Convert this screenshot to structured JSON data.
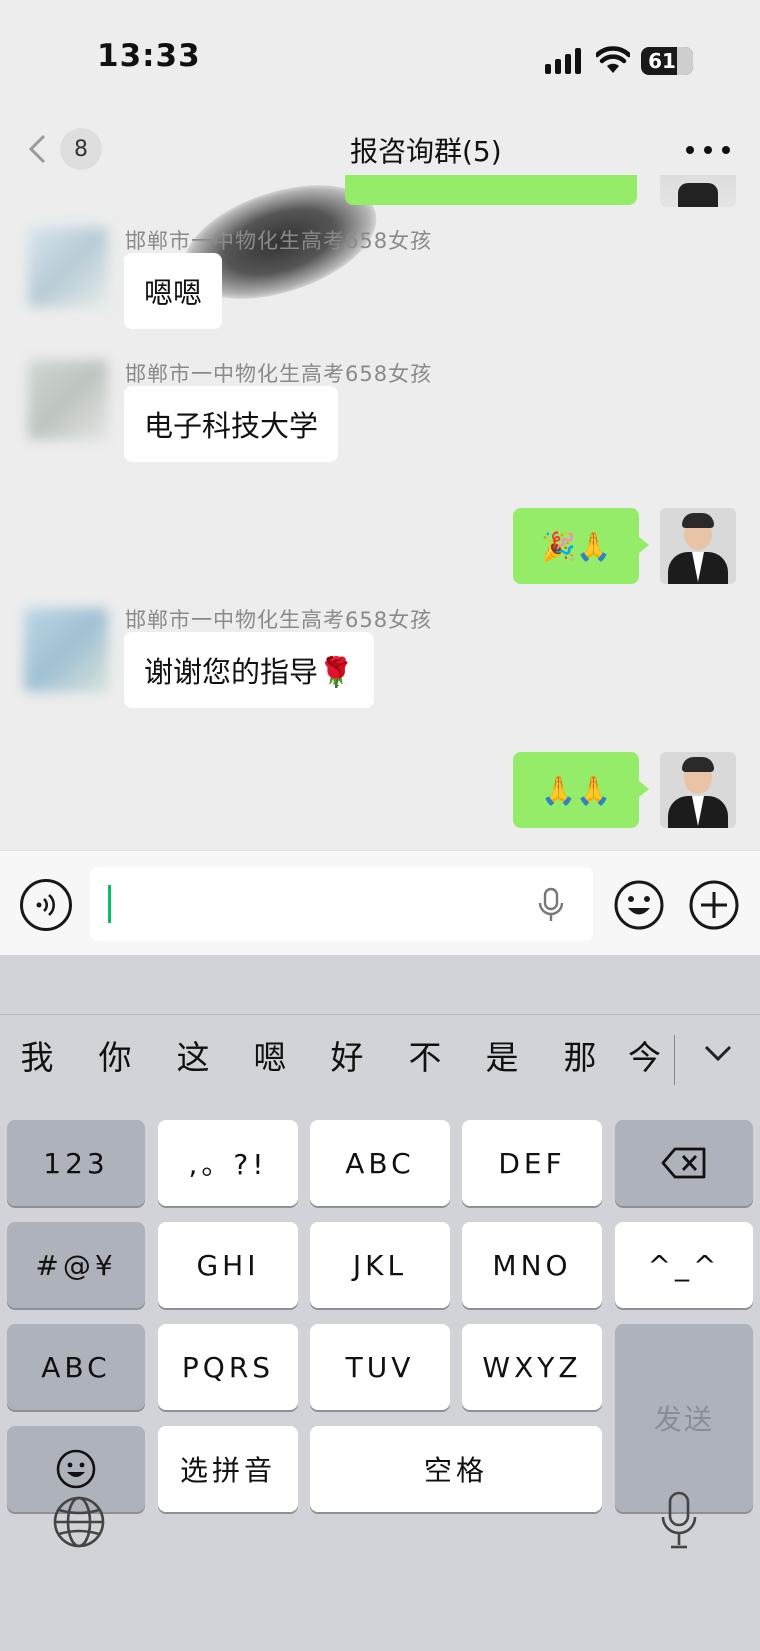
{
  "status_bar": {
    "time": "13:33",
    "battery": "61"
  },
  "nav": {
    "unread_count": "8",
    "title": "报咨询群(5)"
  },
  "messages": [
    {
      "sender": "邯郸市一中物化生高考658女孩",
      "text": "嗯嗯"
    },
    {
      "sender": "邯郸市一中物化生高考658女孩",
      "text": "电子科技大学"
    },
    {
      "text": "🎉🙏"
    },
    {
      "sender": "邯郸市一中物化生高考658女孩",
      "text": "谢谢您的指导🌹"
    },
    {
      "text": "🙏🙏"
    }
  ],
  "input": {
    "value": ""
  },
  "keyboard": {
    "candidates": [
      "我",
      "你",
      "这",
      "嗯",
      "好",
      "不",
      "是",
      "那",
      "今"
    ],
    "keys": {
      "num": "123",
      "punct": ",。?!",
      "abc": "ABC",
      "def": "DEF",
      "symbols": "#@¥",
      "ghi": "GHI",
      "jkl": "JKL",
      "mno": "MNO",
      "emoticon": "^_^",
      "abc_switch": "ABC",
      "pqrs": "PQRS",
      "tuv": "TUV",
      "wxyz": "WXYZ",
      "send": "发送",
      "pinyin": "选拼音",
      "space": "空格"
    }
  },
  "colors": {
    "accent": "#95ec69",
    "caret": "#07c160",
    "background": "#ededed"
  }
}
